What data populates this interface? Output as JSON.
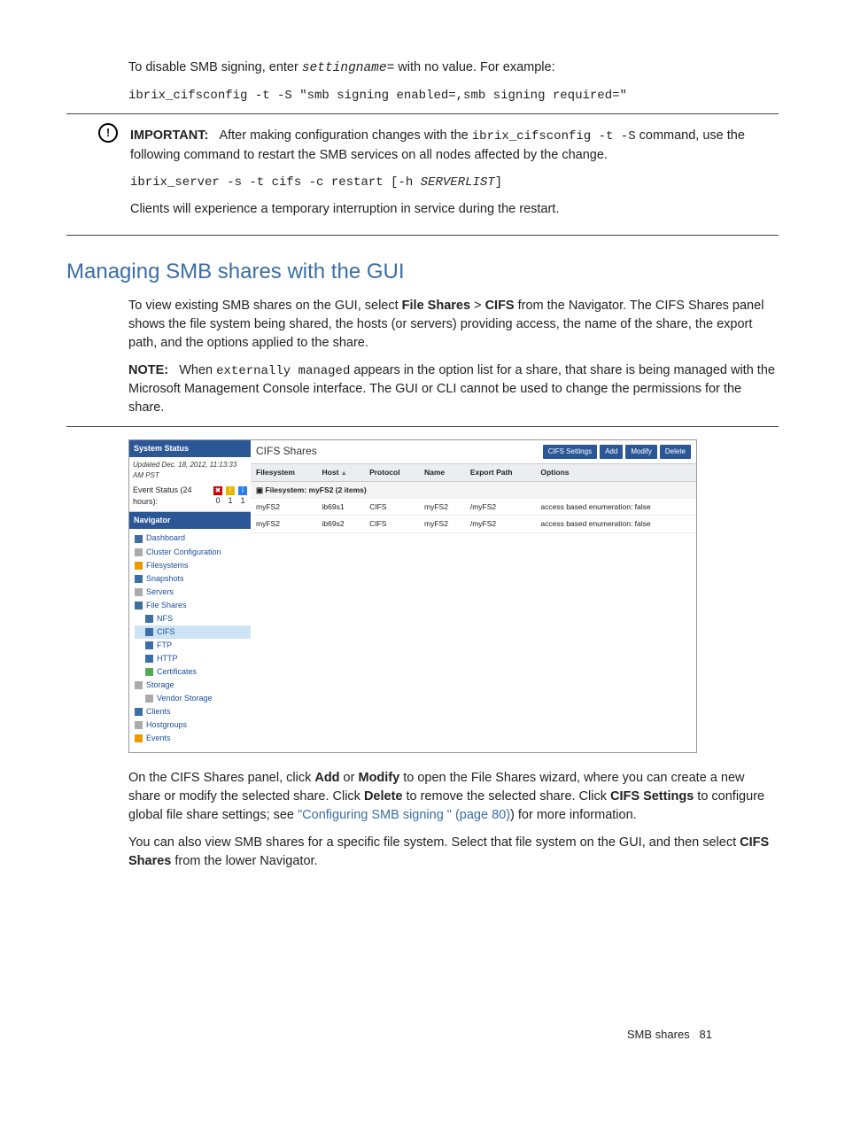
{
  "intro": {
    "line1_a": "To disable SMB signing, enter ",
    "line1_b": "settingname=",
    "line1_c": " with no value. For example:",
    "code1": "ibrix_cifsconfig -t -S \"smb signing enabled=,smb signing required=\""
  },
  "important": {
    "label": "IMPORTANT:",
    "icon_glyph": "!",
    "text_a": "After making configuration changes with the ",
    "cmd": "ibrix_cifsconfig -t -S",
    "text_b": " command, use the following command to restart the SMB services on all nodes affected by the change.",
    "code": "ibrix_server -s -t cifs -c restart [-h SERVERLIST]",
    "after": "Clients will experience a temporary interruption in service during the restart."
  },
  "section_title": "Managing SMB shares with the GUI",
  "para1_a": "To view existing SMB shares on the GUI, select ",
  "para1_b": "File Shares",
  "para1_c": " > ",
  "para1_d": "CIFS",
  "para1_e": " from the Navigator. The CIFS Shares panel shows the file system being shared, the hosts (or servers) providing access, the name of the share, the export path, and the options applied to the share.",
  "note": {
    "label": "NOTE:",
    "text_a": "When ",
    "code": "externally managed",
    "text_b": " appears in the option list for a share, that share is being managed with the Microsoft Management Console interface. The GUI or CLI cannot be used to change the permissions for the share."
  },
  "gui": {
    "status_title": "System Status",
    "updated": "Updated Dec. 18, 2012, 11:13:33 AM PST",
    "event_label": "Event Status (24 hours):",
    "event_counts": [
      "0",
      "1",
      "1"
    ],
    "navigator_title": "Navigator",
    "nav": [
      {
        "label": "Dashboard",
        "cls": "",
        "ic": "blue"
      },
      {
        "label": "Cluster Configuration",
        "cls": "",
        "ic": "grey"
      },
      {
        "label": "Filesystems",
        "cls": "",
        "ic": "orange"
      },
      {
        "label": "Snapshots",
        "cls": "",
        "ic": "blue"
      },
      {
        "label": "Servers",
        "cls": "",
        "ic": "grey"
      },
      {
        "label": "File Shares",
        "cls": "",
        "ic": "blue"
      },
      {
        "label": "NFS",
        "cls": "nav-ind1",
        "ic": "blue"
      },
      {
        "label": "CIFS",
        "cls": "nav-ind1 sel",
        "ic": "blue"
      },
      {
        "label": "FTP",
        "cls": "nav-ind1",
        "ic": "blue"
      },
      {
        "label": "HTTP",
        "cls": "nav-ind1",
        "ic": "blue"
      },
      {
        "label": "Certificates",
        "cls": "nav-ind1",
        "ic": "green"
      },
      {
        "label": "Storage",
        "cls": "",
        "ic": "grey"
      },
      {
        "label": "Vendor Storage",
        "cls": "nav-ind1",
        "ic": "grey"
      },
      {
        "label": "Clients",
        "cls": "",
        "ic": "blue"
      },
      {
        "label": "Hostgroups",
        "cls": "",
        "ic": "grey"
      },
      {
        "label": "Events",
        "cls": "",
        "ic": "orange"
      }
    ],
    "panel_title": "CIFS Shares",
    "buttons": [
      "CIFS Settings",
      "Add",
      "Modify",
      "Delete"
    ],
    "columns": [
      "Filesystem",
      "Host",
      "Protocol",
      "Name",
      "Export Path",
      "Options"
    ],
    "sort_indicator": "▲",
    "group_row": "Filesystem: myFS2 (2 items)",
    "rows": [
      [
        "myFS2",
        "ib69s1",
        "CIFS",
        "myFS2",
        "/myFS2",
        "access based enumeration: false"
      ],
      [
        "myFS2",
        "ib69s2",
        "CIFS",
        "myFS2",
        "/myFS2",
        "access based enumeration: false"
      ]
    ]
  },
  "para2": {
    "a": "On the CIFS Shares panel, click ",
    "add": "Add",
    "b": " or ",
    "mod": "Modify",
    "c": " to open the File Shares wizard, where you can create a new share or modify the selected share. Click ",
    "del": "Delete",
    "d": " to remove the selected share. Click ",
    "set": "CIFS Settings",
    "e": " to configure global file share settings; see ",
    "link": "\"Configuring SMB signing \" (page 80)",
    "f": ") for more information."
  },
  "para3": {
    "a": "You can also view SMB shares for a specific file system. Select that file system on the GUI, and then select ",
    "b": "CIFS Shares",
    "c": " from the lower Navigator."
  },
  "footer": {
    "label": "SMB shares",
    "page": "81"
  }
}
